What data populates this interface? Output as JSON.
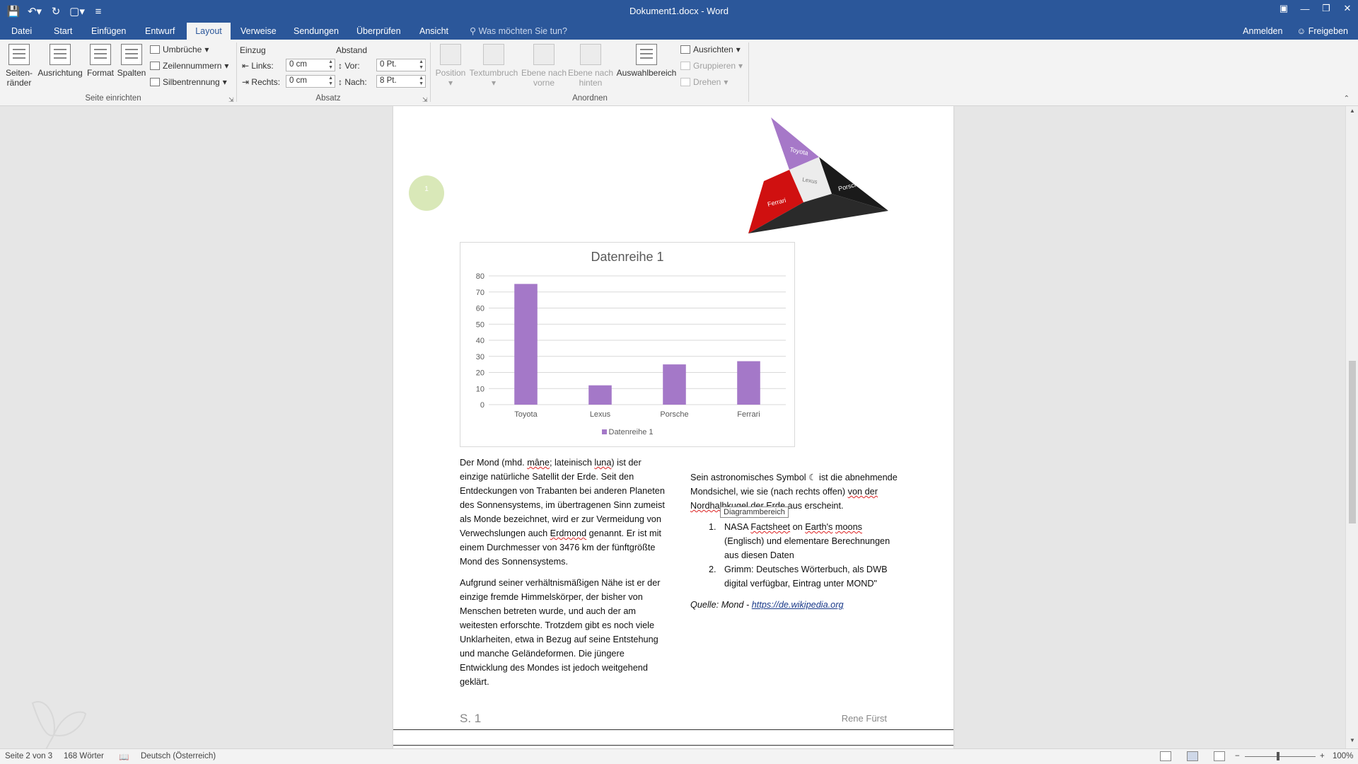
{
  "window": {
    "title": "Dokument1.docx - Word"
  },
  "tabs": [
    {
      "label": "Datei"
    },
    {
      "label": "Start"
    },
    {
      "label": "Einfügen"
    },
    {
      "label": "Entwurf"
    },
    {
      "label": "Layout"
    },
    {
      "label": "Verweise"
    },
    {
      "label": "Sendungen"
    },
    {
      "label": "Überprüfen"
    },
    {
      "label": "Ansicht"
    }
  ],
  "active_tab": "Layout",
  "tellme": "Was möchten Sie tun?",
  "account": {
    "signin": "Anmelden",
    "share": "Freigeben"
  },
  "ribbon": {
    "seite_einrichten": {
      "label": "Seite einrichten",
      "margins": "Seiten-\nränder",
      "orientation": "Ausrichtung",
      "format": "Format",
      "columns": "Spalten",
      "breaks": "Umbrüche",
      "line_numbers": "Zeilennummern",
      "hyphenation": "Silbentrennung"
    },
    "absatz": {
      "label": "Absatz",
      "indent": "Einzug",
      "spacing": "Abstand",
      "left": "Links:",
      "right": "Rechts:",
      "left_value": "0 cm",
      "right_value": "0 cm",
      "before": "Vor:",
      "after": "Nach:",
      "before_value": "0 Pt.",
      "after_value": "8 Pt."
    },
    "anordnen": {
      "label": "Anordnen",
      "position": "Position",
      "wrap": "Textumbruch",
      "forward": "Ebene nach\nvorne",
      "backward": "Ebene nach\nhinten",
      "selection": "Auswahlbereich",
      "align": "Ausrichten",
      "group": "Gruppieren",
      "rotate": "Drehen"
    }
  },
  "document": {
    "badge": "1",
    "pyramid_labels": [
      "Toyota",
      "Lexus",
      "Porsche",
      "Ferrari"
    ],
    "col1": {
      "p1_a": "Der Mond (mhd. ",
      "p1_mane": "mâne",
      "p1_b": "; lateinisch ",
      "p1_luna": "luna",
      "p1_c": ") ist der einzige natürliche Satellit der Erde. Seit den Entdeckungen von Trabanten bei anderen Planeten des Sonnensystems, im übertragenen Sinn zumeist als Monde bezeichnet, wird er zur Vermeidung von Verwechslungen auch ",
      "p1_erdmond": "Erdmond",
      "p1_d": " genannt. Er ist mit einem Durchmesser von 3476 km der fünftgrößte Mond des Sonnensystems.",
      "p2": "Aufgrund seiner verhältnismäßigen Nähe ist er der einzige fremde Himmelskörper, der bisher von Menschen betreten wurde, und auch der am weitesten erforschte. Trotzdem gibt es noch viele Unklarheiten, etwa in Bezug auf seine Entstehung und manche Geländeformen. Die jüngere Entwicklung des Mondes ist jedoch weitgehend geklärt."
    },
    "col2": {
      "p1_a": "Sein astronomisches Symbol ☾ ist die abnehmende Mondsichel, wie sie (nach rechts offen) ",
      "p1_b": "von der Nordhalbkugel",
      "p1_c": " der Erde aus erscheint.",
      "list": [
        {
          "num": "1.",
          "a": "NASA ",
          "b": "Factsheet",
          "c": " on ",
          "d": "Earth's",
          "e": " ",
          "f": "moons",
          "g": " (Englisch) und elementare Berechnungen aus diesen Daten"
        },
        {
          "num": "2.",
          "text": "Grimm: Deutsches Wörterbuch, als DWB digital verfügbar, Eintrag unter MOND\""
        }
      ],
      "source_label": "Quelle: Mond - ",
      "source_link": "https://de.wikipedia.org"
    },
    "tooltip": "Diagrammbereich",
    "footer_page": "S. 1",
    "footer_author": "Rene Fürst"
  },
  "chart_data": {
    "type": "bar",
    "title": "Datenreihe 1",
    "categories": [
      "Toyota",
      "Lexus",
      "Porsche",
      "Ferrari"
    ],
    "series": [
      {
        "name": "Datenreihe 1",
        "values": [
          75,
          12,
          25,
          27
        ]
      }
    ],
    "ylim": [
      0,
      80
    ],
    "yticks": [
      0,
      10,
      20,
      30,
      40,
      50,
      60,
      70,
      80
    ],
    "grid": true,
    "legend": "bottom",
    "bar_color": "#a478c8"
  },
  "statusbar": {
    "page": "Seite 2 von 3",
    "words": "168 Wörter",
    "language": "Deutsch (Österreich)",
    "zoom": "100%"
  },
  "colors": {
    "brand": "#2b579a"
  }
}
